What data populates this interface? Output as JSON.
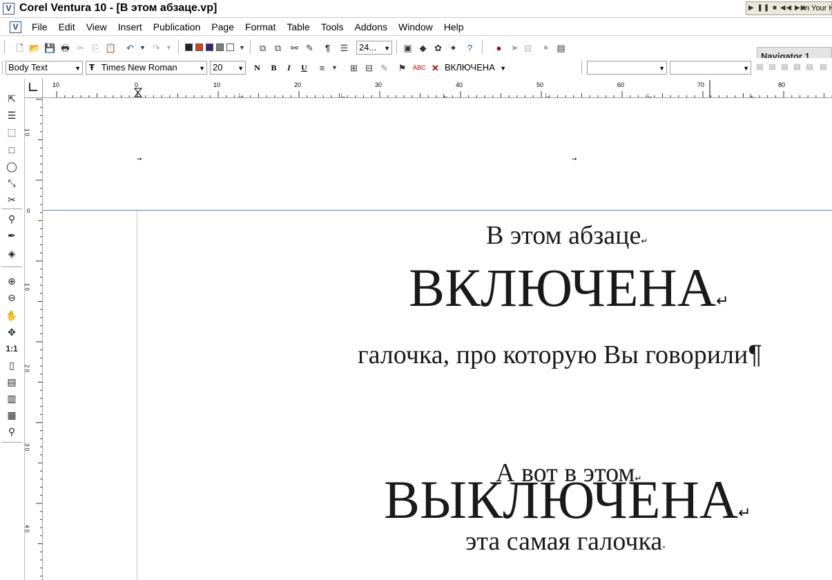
{
  "window": {
    "title": "Corel Ventura 10 - [В этом абзаце.vp]",
    "app_icon": "V",
    "media_label": "In Your H",
    "media_controls": "▶ ❚❚ ■ ◀◀ ▶▶"
  },
  "menu": {
    "items": [
      "File",
      "Edit",
      "View",
      "Insert",
      "Publication",
      "Page",
      "Format",
      "Table",
      "Tools",
      "Addons",
      "Window",
      "Help"
    ]
  },
  "toolbar": {
    "zoom_value": "24...",
    "colors": [
      "#222222",
      "#d9401a",
      "#3b1f7a",
      "#7d7d7d",
      "#ffffff"
    ]
  },
  "format_bar": {
    "paragraph_tag": "Body Text",
    "font_family": "Times New Roman",
    "font_size": "20",
    "normal_label": "N",
    "bold_label": "B",
    "italic_label": "I",
    "underline_label": "U",
    "tag_status": "ВКЛЮЧЕНА",
    "font_icon": "Ŧ"
  },
  "navigator": {
    "title": "Navigator 1"
  },
  "ruler_h": {
    "labels": [
      "10",
      "0",
      "10",
      "20",
      "30",
      "40",
      "50",
      "60",
      "70",
      "80"
    ]
  },
  "ruler_v": {
    "labels": [
      "1 0",
      "0",
      "1 0",
      "2 0",
      "3 0",
      "4 0"
    ]
  },
  "document": {
    "line1": "В этом абзаце",
    "line2": "ВКЛЮЧЕНА",
    "line3": "галочка, про которую Вы говорили",
    "line4": "А вот в этом",
    "line5": "ВЫКЛЮЧЕНА",
    "line6": "эта самая галочка",
    "pilcrow": "¶",
    "return_mark": "↵",
    "end_mark": "▫"
  }
}
